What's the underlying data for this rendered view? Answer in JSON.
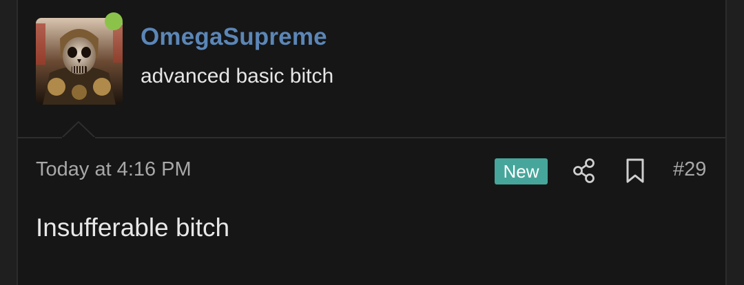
{
  "user": {
    "name": "OmegaSupreme",
    "title": "advanced basic bitch",
    "online": true,
    "avatar_icon": "armored-skull-avatar"
  },
  "post": {
    "timestamp": "Today at 4:16 PM",
    "badge": "New",
    "number": "#29",
    "message": "Insufferable bitch",
    "actions": [
      "share-icon",
      "bookmark-icon"
    ]
  },
  "colors": {
    "username": "#5b86b7",
    "badge": "#47a69b",
    "online": "#8bc34a",
    "background": "#161616"
  }
}
